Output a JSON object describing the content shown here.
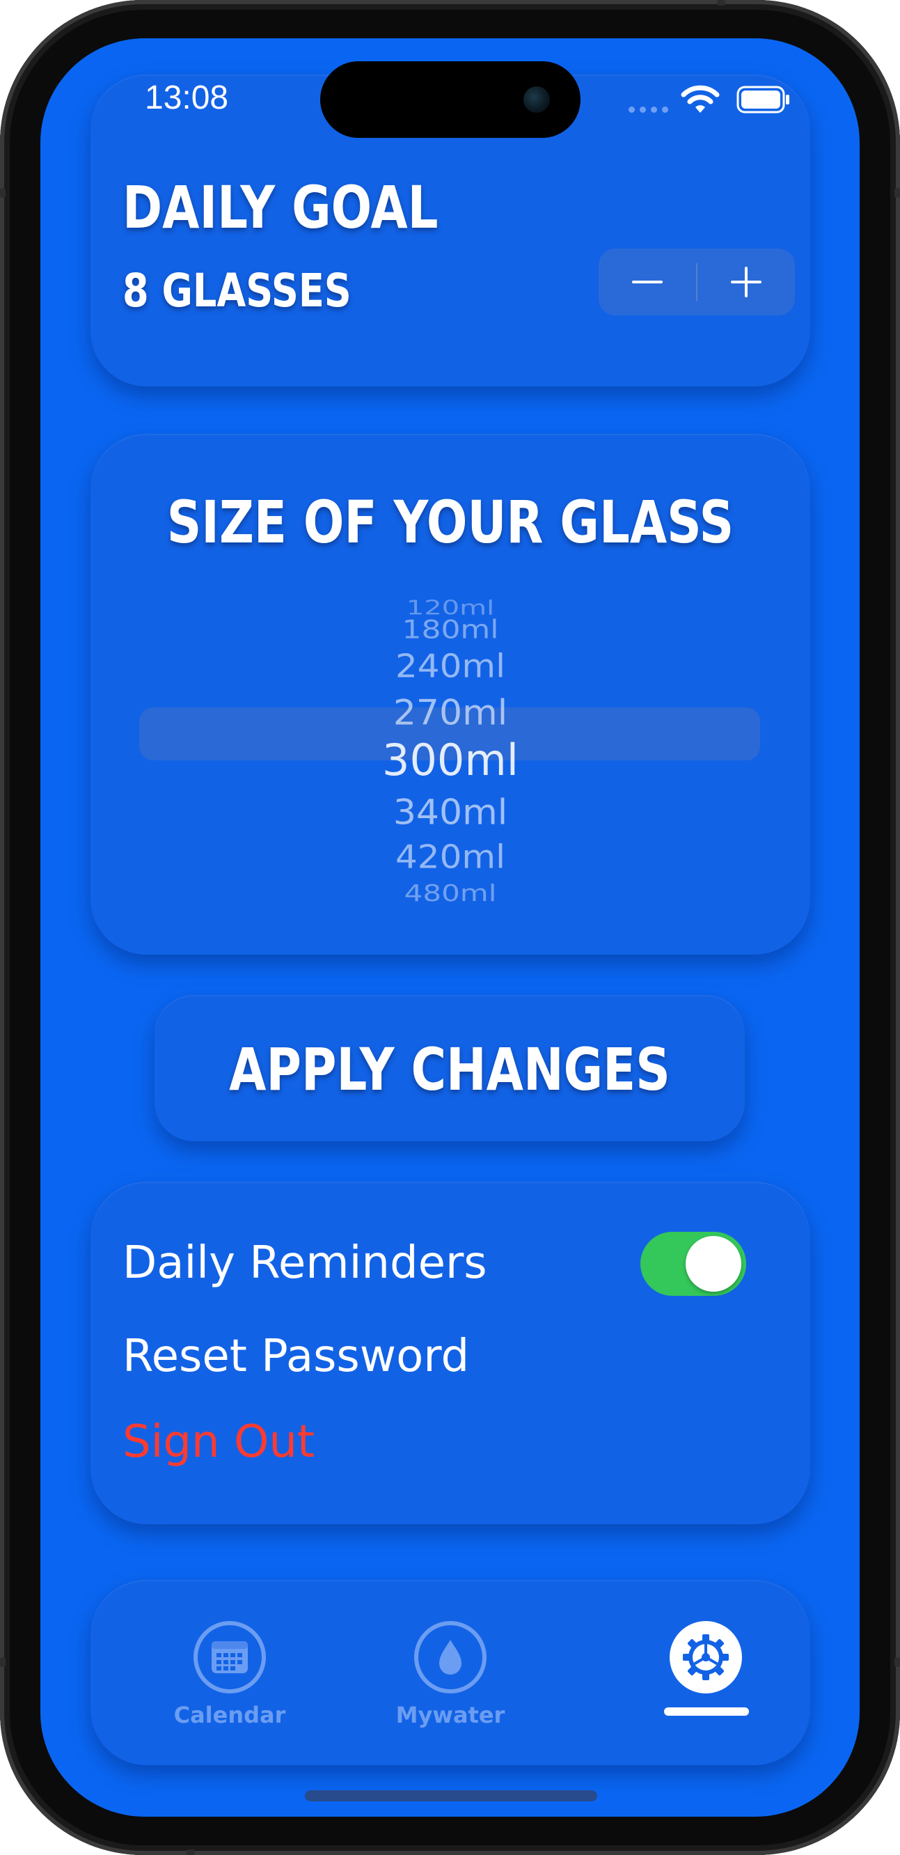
{
  "status_bar": {
    "time": "13:08"
  },
  "daily_goal": {
    "title": "DAILY GOAL",
    "value_label": "8 GLASSES",
    "minus_symbol": "−",
    "plus_symbol": "+"
  },
  "glass_size": {
    "title": "SIZE OF YOUR GLASS",
    "options": [
      "120ml",
      "180ml",
      "240ml",
      "270ml",
      "300ml",
      "340ml",
      "420ml",
      "480ml"
    ],
    "selected": "300ml"
  },
  "apply_button": {
    "label": "APPLY CHANGES"
  },
  "settings": {
    "daily_reminders_label": "Daily Reminders",
    "daily_reminders_on": true,
    "reset_password_label": "Reset Password",
    "sign_out_label": "Sign Out"
  },
  "tab_bar": {
    "tabs": [
      {
        "label": "Calendar",
        "icon": "calendar-icon"
      },
      {
        "label": "Mywater",
        "icon": "water-drop-icon"
      },
      {
        "label": "",
        "icon": "gear-icon",
        "selected": true
      }
    ]
  },
  "colors": {
    "background": "#0a66f2",
    "card": "#1262e6",
    "toggle_on": "#34c759",
    "sign_out": "#ff3b30",
    "tab_inactive": "#6b9df2"
  }
}
